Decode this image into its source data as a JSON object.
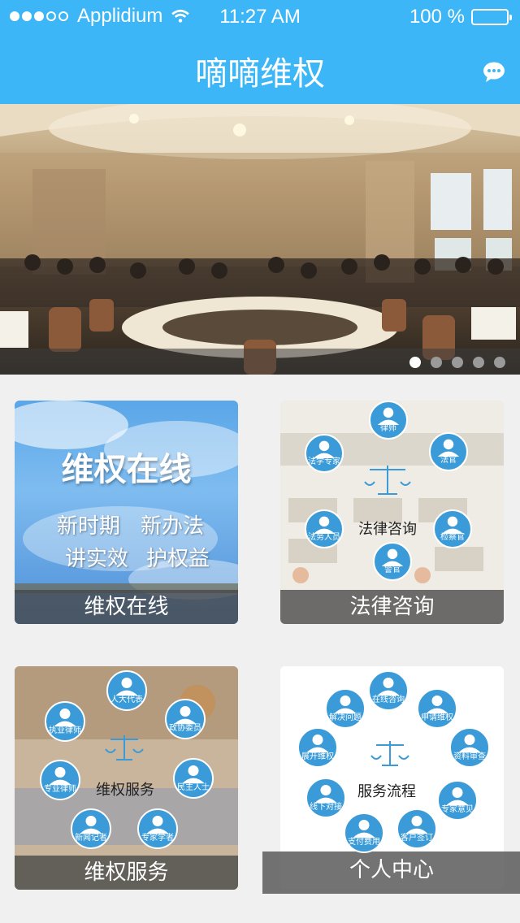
{
  "status_bar": {
    "carrier": "Applidium",
    "time": "11:27 AM",
    "battery": "100 %"
  },
  "header": {
    "title": "嘀嘀维权",
    "chat_icon": "chat-bubble-icon"
  },
  "banner": {
    "pages": 5,
    "active_page": 1
  },
  "tiles": [
    {
      "caption": "维权在线",
      "headline": "维权在线",
      "lines": [
        "新时期",
        "新办法",
        "讲实效",
        "护权益"
      ]
    },
    {
      "caption": "法律咨询",
      "center": "法律咨询",
      "nodes": [
        "律师",
        "法官",
        "检察官",
        "警官",
        "法务人员",
        "法学专家"
      ]
    },
    {
      "caption": "维权服务",
      "center": "维权服务",
      "nodes": [
        "人大代表",
        "政协委员",
        "民主人士",
        "专家学者",
        "新闻记者",
        "专业律师",
        "执业律师"
      ]
    },
    {
      "caption": "个人中心",
      "center": "服务流程",
      "nodes": [
        "在线咨询",
        "申请维权",
        "资料审查",
        "专家意见",
        "客户签订",
        "支付费用",
        "线下对接",
        "展开维权",
        "解决问题"
      ]
    }
  ],
  "colors": {
    "brand": "#3cb6f6",
    "node": "#3a9bd8"
  }
}
